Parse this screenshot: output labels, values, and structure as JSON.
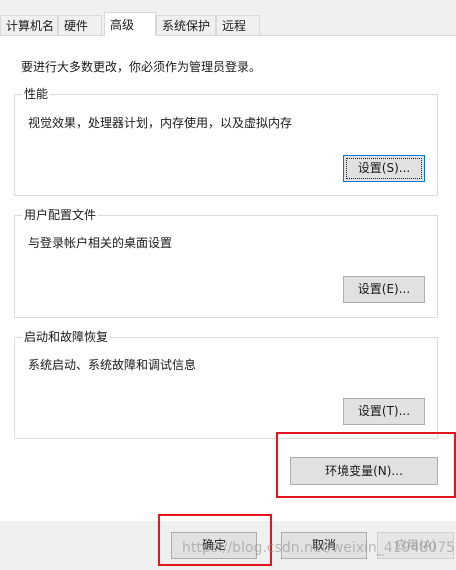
{
  "tabs": [
    {
      "label": "计算机名"
    },
    {
      "label": "硬件"
    },
    {
      "label": "高级"
    },
    {
      "label": "系统保护"
    },
    {
      "label": "远程"
    }
  ],
  "intro_text": "要进行大多数更改，你必须作为管理员登录。",
  "performance": {
    "title": "性能",
    "description": "视觉效果，处理器计划，内存使用，以及虚拟内存",
    "button": "设置(S)..."
  },
  "user_profiles": {
    "title": "用户配置文件",
    "description": "与登录帐户相关的桌面设置",
    "button": "设置(E)..."
  },
  "startup_recovery": {
    "title": "启动和故障恢复",
    "description": "系统启动、系统故障和调试信息",
    "button": "设置(T)..."
  },
  "env_button": "环境变量(N)...",
  "footer": {
    "ok": "确定",
    "cancel": "取消",
    "apply": "应用(A)"
  },
  "watermark": "https://blog.csdn.net/weixin_41948075",
  "colors": {
    "highlight": "#e3161d",
    "focus": "#0078d7"
  }
}
